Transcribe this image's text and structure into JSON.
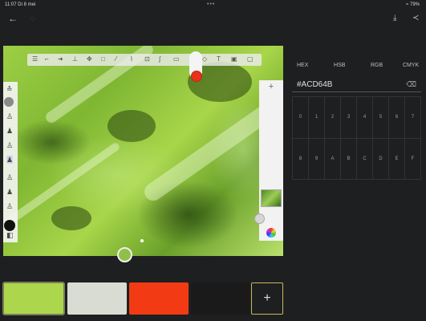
{
  "status": {
    "time": "11:07  Di 8 mei",
    "dots": "•••",
    "battery": "≈ 79%"
  },
  "topbar": {
    "back_icon": "arrow-left-icon",
    "history_icon": "history-icon",
    "download_icon": "download-icon",
    "share_icon": "share-icon"
  },
  "color_picker": {
    "tabs": [
      "HEX",
      "HSB",
      "RGB",
      "CMYK"
    ],
    "hex_value": "#ACD64B",
    "backspace_icon": "backspace-icon",
    "keys": [
      "0",
      "1",
      "2",
      "3",
      "4",
      "5",
      "6",
      "7",
      "8",
      "9",
      "A",
      "B",
      "C",
      "D",
      "E",
      "F"
    ]
  },
  "layers": {
    "add_label": "+"
  },
  "swatches": {
    "colors": [
      "#ACD64B",
      "#D8DCD3",
      "#F23B14",
      "#1A1A1A"
    ],
    "selected_index": 0,
    "add_label": "+"
  },
  "colors": {
    "accent": "#ACD64B",
    "current_brush": "#E8321C"
  }
}
